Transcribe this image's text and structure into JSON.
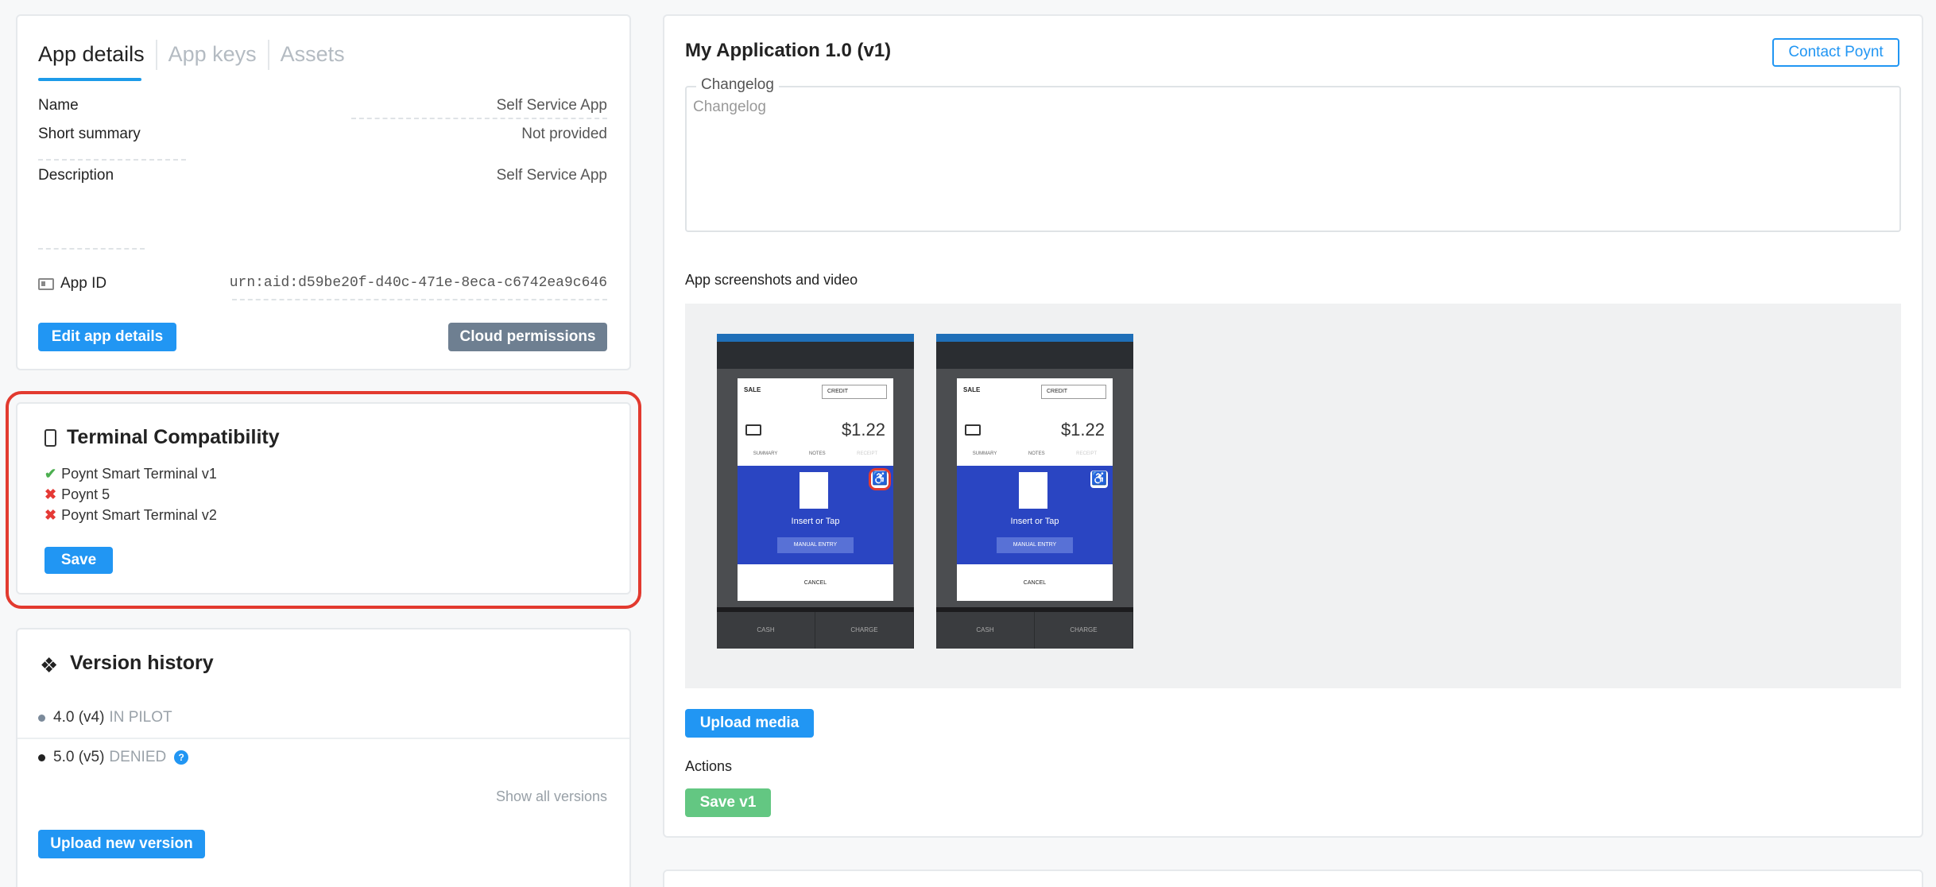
{
  "tabs": [
    {
      "label": "App details",
      "active": true
    },
    {
      "label": "App keys",
      "active": false
    },
    {
      "label": "Assets",
      "active": false
    }
  ],
  "details": {
    "name_label": "Name",
    "name_value": "Self Service App",
    "summary_label": "Short summary",
    "summary_value": "Not provided",
    "description_label": "Description",
    "description_value": "Self Service App",
    "app_id_label": "App ID",
    "app_id_value": "urn:aid:d59be20f-d40c-471e-8eca-c6742ea9c646",
    "edit_button": "Edit app details",
    "cloud_button": "Cloud permissions"
  },
  "terminal": {
    "title": "Terminal Compatibility",
    "items": [
      {
        "label": "Poynt Smart Terminal v1",
        "supported": true
      },
      {
        "label": "Poynt 5",
        "supported": false
      },
      {
        "label": "Poynt Smart Terminal v2",
        "supported": false
      }
    ],
    "save_button": "Save"
  },
  "versions": {
    "title": "Version history",
    "items": [
      {
        "version": "4.0 (v4)",
        "status": "IN PILOT",
        "dot_color": "#7b8a9a"
      },
      {
        "version": "5.0 (v5)",
        "status": "DENIED",
        "dot_color": "#222222"
      }
    ],
    "show_all": "Show all versions",
    "upload_button": "Upload new version"
  },
  "main": {
    "title": "My Application 1.0 (v1)",
    "contact_button": "Contact Poynt",
    "changelog_legend": "Changelog",
    "changelog_placeholder": "Changelog",
    "media_label": "App screenshots and video",
    "upload_media_button": "Upload media",
    "actions_label": "Actions",
    "save_version_button": "Save v1"
  },
  "phone": {
    "sale": "SALE",
    "select": "CREDIT",
    "amount": "$1.22",
    "tabs": [
      "SUMMARY",
      "NOTES",
      "RECEIPT"
    ],
    "insert": "Insert or Tap",
    "manual": "MANUAL ENTRY",
    "cancel": "CANCEL",
    "bottom": [
      "CASH",
      "CHARGE"
    ]
  },
  "colors": {
    "accent": "#2196f3",
    "highlight": "#e23a2f",
    "success": "#4caf50",
    "danger": "#e53935"
  }
}
